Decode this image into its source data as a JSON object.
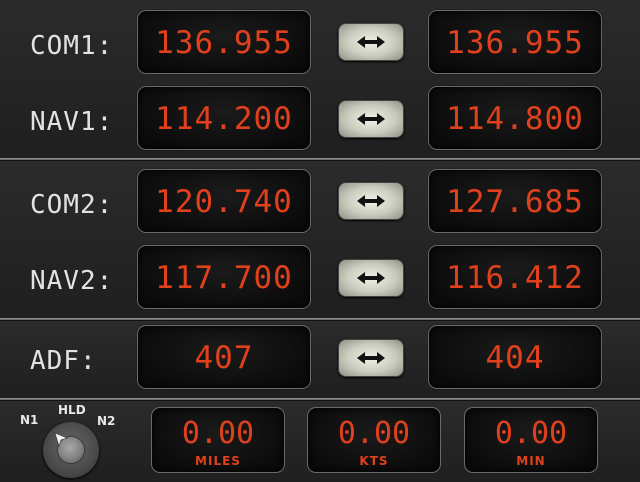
{
  "radios": [
    {
      "label": "COM1:",
      "active": "136.955",
      "standby": "136.955"
    },
    {
      "label": "NAV1:",
      "active": "114.200",
      "standby": "114.800"
    },
    {
      "label": "COM2:",
      "active": "120.740",
      "standby": "127.685"
    },
    {
      "label": "NAV2:",
      "active": "117.700",
      "standby": "116.412"
    },
    {
      "label": "ADF:",
      "active": "407",
      "standby": "404"
    }
  ],
  "swap_icon": "double-arrow-icon",
  "dme": {
    "knob": {
      "left": "N1",
      "center": "HLD",
      "right": "N2"
    },
    "miles": {
      "value": "0.00",
      "unit": "MILES"
    },
    "speed": {
      "value": "0.00",
      "unit": "KTS"
    },
    "time": {
      "value": "0.00",
      "unit": "MIN"
    }
  },
  "colors": {
    "digits": "#e0401c",
    "label": "#e2e2e2",
    "background": "#232323"
  }
}
